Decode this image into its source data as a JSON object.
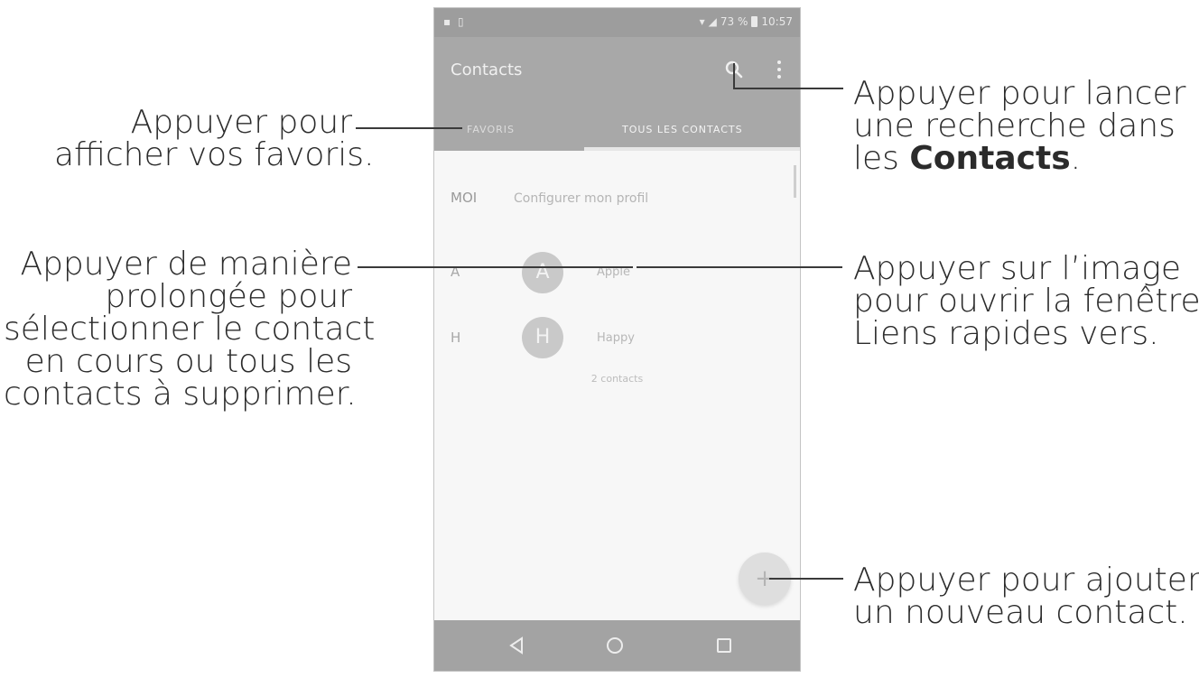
{
  "status_bar": {
    "left_icons": "▪ ▯",
    "battery_percent": "73 %",
    "time": "10:57"
  },
  "app_bar": {
    "title": "Contacts",
    "tab_favorites": "FAVORIS",
    "tab_all": "TOUS LES CONTACTS"
  },
  "list": {
    "me_label": "MOI",
    "me_text": "Configurer mon profil",
    "contacts": [
      {
        "section": "A",
        "initial": "A",
        "name": "Apple"
      },
      {
        "section": "H",
        "initial": "H",
        "name": "Happy"
      }
    ],
    "count": "2 contacts",
    "fab_symbol": "+"
  },
  "callouts": {
    "favorites": [
      "Appuyer pour",
      "afficher vos favoris."
    ],
    "long_press": [
      "Appuyer de manière",
      "prolongée pour",
      "sélectionner le contact",
      "en cours ou tous les",
      "contacts à supprimer."
    ],
    "search": [
      "Appuyer pour lancer",
      "une recherche dans"
    ],
    "search_last_prefix": "les ",
    "search_last_bold": "Contacts",
    "search_last_suffix": ".",
    "image": [
      "Appuyer sur l’image",
      "pour ouvrir la fenêtre",
      "Liens rapides vers."
    ],
    "add": [
      "Appuyer pour ajouter",
      "un nouveau contact."
    ]
  },
  "colors": {
    "app_bar": "#a8a8a8",
    "nav_bar": "#a3a3a3",
    "text": "#2b2b2b"
  }
}
